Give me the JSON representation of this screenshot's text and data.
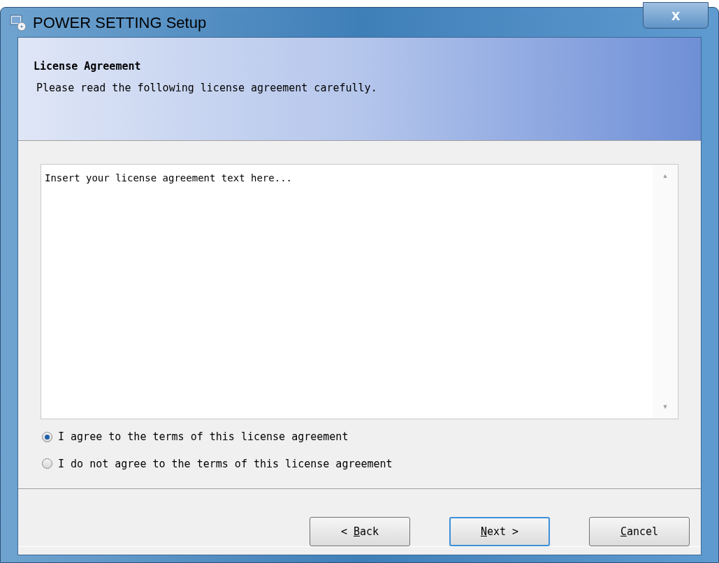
{
  "window": {
    "title": "POWER SETTING Setup",
    "close": "x"
  },
  "header": {
    "title": "License Agreement",
    "subtitle": "Please read the following license agreement carefully."
  },
  "license_text": "Insert your license agreement text here...",
  "scroll": {
    "up": "▲",
    "down": "▼"
  },
  "options": [
    {
      "label": "I agree to the terms of this license agreement",
      "selected": true
    },
    {
      "label": "I do not agree to the terms of this license agreement",
      "selected": false
    }
  ],
  "buttons": [
    {
      "before": "< ",
      "key": "B",
      "after": "ack",
      "default": false
    },
    {
      "key": "N",
      "after": "ext >",
      "default": true
    },
    {
      "key": "C",
      "after": "ancel",
      "default": false
    }
  ]
}
